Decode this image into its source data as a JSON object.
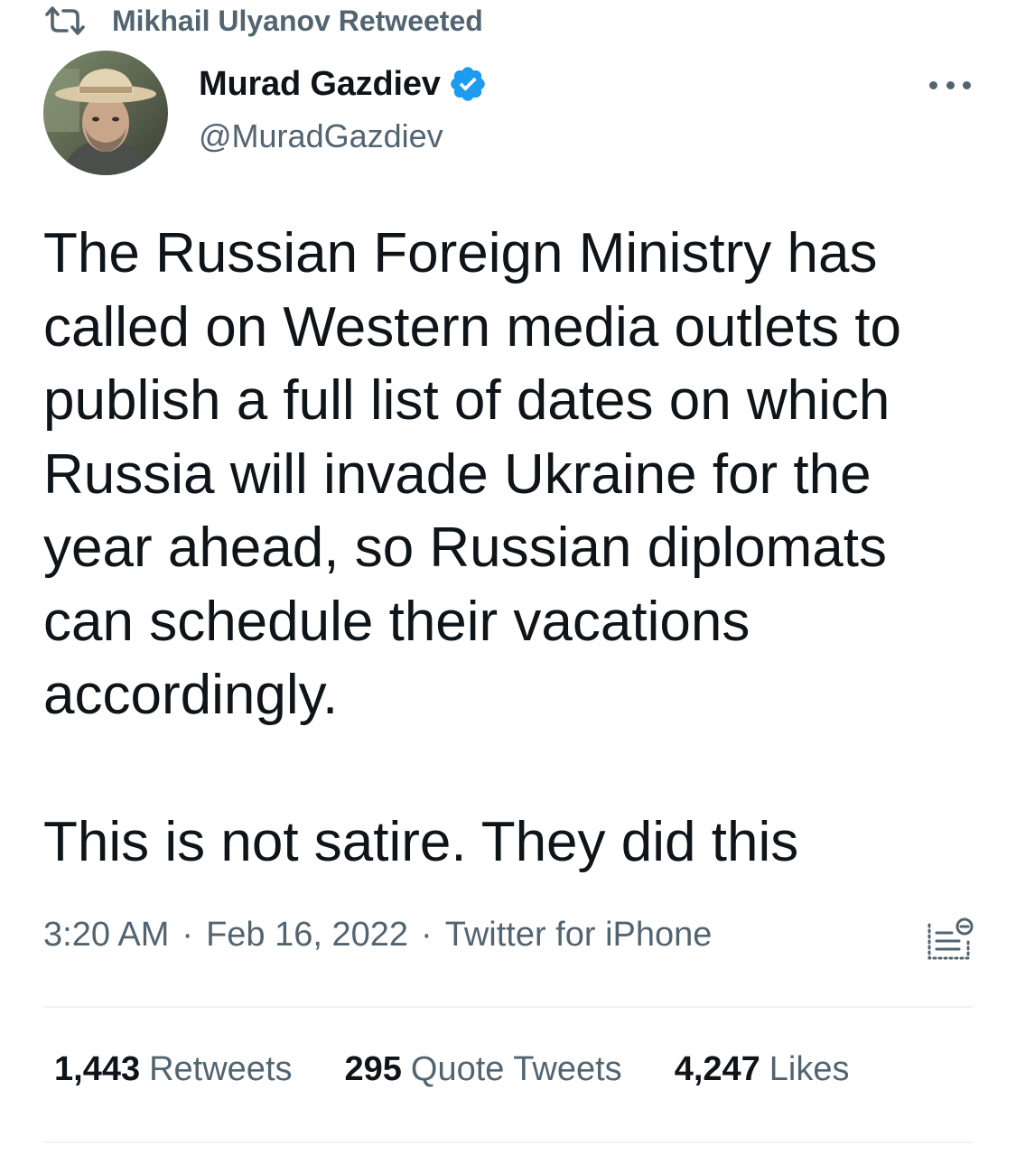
{
  "retweeted_by": "Mikhail Ulyanov Retweeted",
  "author": {
    "display_name": "Murad Gazdiev",
    "handle": "@MuradGazdiev",
    "verified": true
  },
  "tweet": {
    "paragraph1": "The Russian Foreign Ministry has called on Western media outlets to publish a full list of dates on which Russia will invade Ukraine for the year ahead, so Russian diplomats can schedule their vacations accordingly.",
    "paragraph2": "This is not satire. They did this"
  },
  "meta": {
    "time": "3:20 AM",
    "date": "Feb 16, 2022",
    "source": "Twitter for iPhone",
    "separator": "·"
  },
  "stats": {
    "retweets_count": "1,443",
    "retweets_label": "Retweets",
    "quotes_count": "295",
    "quotes_label": "Quote Tweets",
    "likes_count": "4,247",
    "likes_label": "Likes"
  },
  "colors": {
    "text": "#0f1419",
    "secondary": "#536471",
    "verified": "#1d9bf0",
    "divider": "#eff3f4"
  },
  "icons": [
    "retweet-icon",
    "verified-badge-icon",
    "more-options-icon",
    "analytics-icon"
  ]
}
